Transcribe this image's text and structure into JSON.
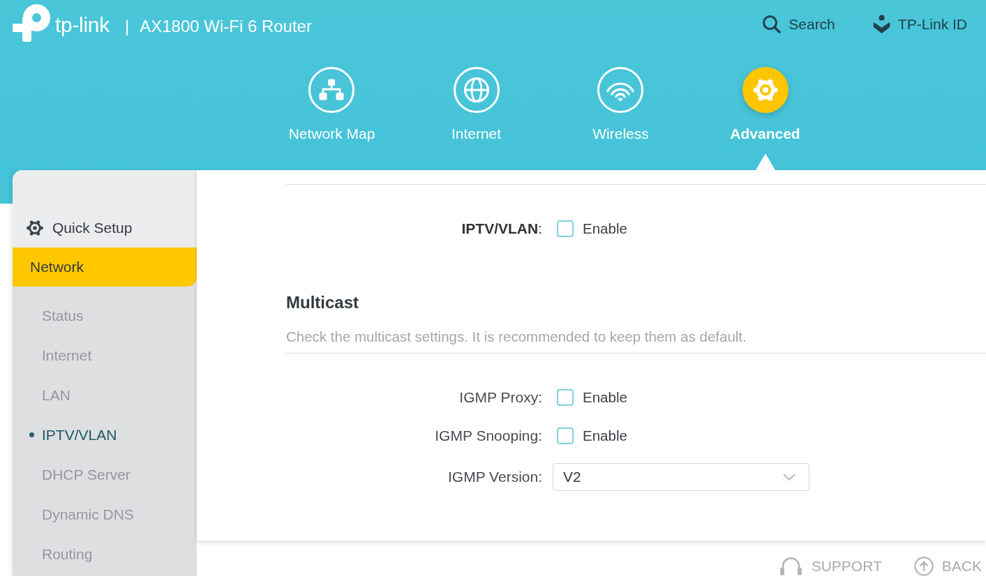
{
  "header": {
    "logo_text": "tp-link",
    "separator": "|",
    "product_name": "AX1800 Wi-Fi 6 Router",
    "actions": [
      {
        "label": "Search"
      },
      {
        "label": "TP-Link ID"
      }
    ]
  },
  "nav_tabs": [
    {
      "label": "Network Map",
      "selected": false
    },
    {
      "label": "Internet",
      "selected": false
    },
    {
      "label": "Wireless",
      "selected": false
    },
    {
      "label": "Advanced",
      "selected": true
    }
  ],
  "sidebar": {
    "items": [
      {
        "kind": "shortcut",
        "label": "Quick Setup",
        "selected": false
      },
      {
        "kind": "group",
        "label": "Network",
        "selected": true,
        "children": [
          {
            "label": "Status",
            "selected": false
          },
          {
            "label": "Internet",
            "selected": false
          },
          {
            "label": "LAN",
            "selected": false
          },
          {
            "label": "IPTV/VLAN",
            "selected": true
          },
          {
            "label": "DHCP Server",
            "selected": false
          },
          {
            "label": "Dynamic DNS",
            "selected": false
          },
          {
            "label": "Routing",
            "selected": false
          }
        ]
      }
    ]
  },
  "content": {
    "iptv": {
      "label": "**IPTV/VLAN**:",
      "option": "Enable",
      "checked": false
    },
    "multicast": {
      "title": "Multicast",
      "description": "Check the multicast settings. It is recommended to keep them as default.",
      "rows": [
        {
          "kind": "checkbox",
          "label": "IGMP Proxy:",
          "option": "Enable",
          "checked": false
        },
        {
          "kind": "checkbox",
          "label": "IGMP Snooping:",
          "option": "Enable",
          "checked": false
        },
        {
          "kind": "select",
          "label": "IGMP Version:",
          "value": "V2"
        }
      ]
    }
  },
  "footer": {
    "links": [
      {
        "label": "SUPPORT"
      },
      {
        "label": "BACK"
      }
    ]
  }
}
